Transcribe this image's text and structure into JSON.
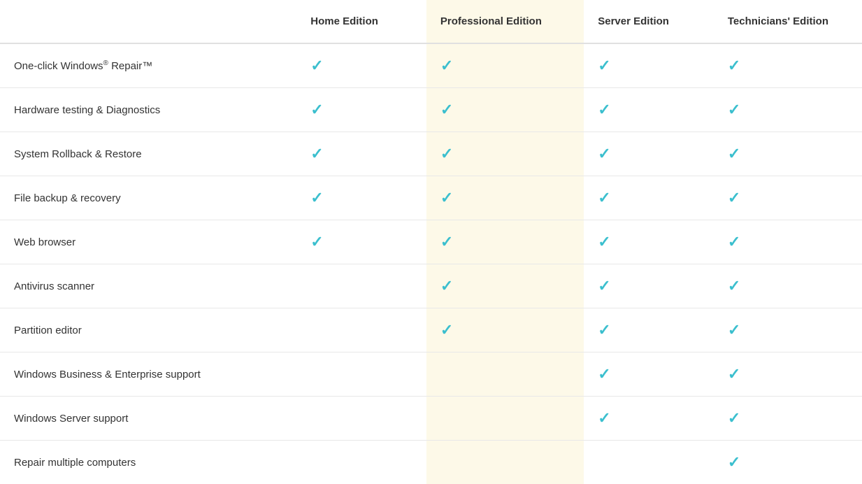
{
  "table": {
    "columns": {
      "feature": "",
      "home": "Home Edition",
      "professional": "Professional Edition",
      "server": "Server Edition",
      "technicians": "Technicians' Edition"
    },
    "rows": [
      {
        "feature": "One-click Windows® Repair™",
        "feature_html": true,
        "home": true,
        "professional": true,
        "server": true,
        "technicians": true
      },
      {
        "feature": "Hardware testing & Diagnostics",
        "home": true,
        "professional": true,
        "server": true,
        "technicians": true
      },
      {
        "feature": "System Rollback & Restore",
        "home": true,
        "professional": true,
        "server": true,
        "technicians": true
      },
      {
        "feature": "File backup & recovery",
        "home": true,
        "professional": true,
        "server": true,
        "technicians": true
      },
      {
        "feature": "Web browser",
        "home": true,
        "professional": true,
        "server": true,
        "technicians": true
      },
      {
        "feature": "Antivirus scanner",
        "home": false,
        "professional": true,
        "server": true,
        "technicians": true
      },
      {
        "feature": "Partition editor",
        "home": false,
        "professional": true,
        "server": true,
        "technicians": true
      },
      {
        "feature": "Windows Business & Enterprise support",
        "home": false,
        "professional": false,
        "server": true,
        "technicians": true
      },
      {
        "feature": "Windows Server support",
        "home": false,
        "professional": false,
        "server": true,
        "technicians": true
      },
      {
        "feature": "Repair multiple computers",
        "home": false,
        "professional": false,
        "server": false,
        "technicians": true
      }
    ],
    "check_symbol": "✓"
  }
}
